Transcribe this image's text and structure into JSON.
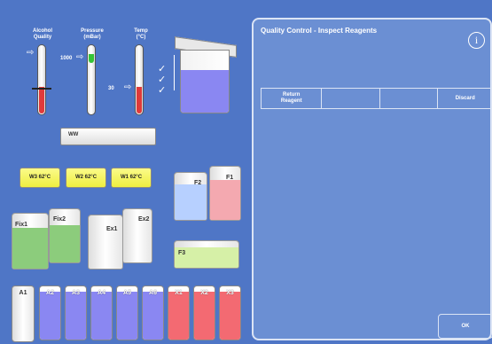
{
  "gauges": {
    "alcohol_label": "Alcohol\nQuality",
    "pressure_label": "Pressure\n(mBar)",
    "temp_label": "Temp\n(°C)",
    "pressure_value": "1000",
    "temp_value": "30"
  },
  "wax_tray": {
    "label": "WW"
  },
  "wax_baths": [
    {
      "label": "W3   62°C"
    },
    {
      "label": "W2   62°C"
    },
    {
      "label": "W1   62°C"
    }
  ],
  "formalin": [
    {
      "label": "F2"
    },
    {
      "label": "F1"
    },
    {
      "label": "F3"
    }
  ],
  "fix_bottles": [
    {
      "label": "Fix1"
    },
    {
      "label": "Fix2"
    }
  ],
  "ex_bottles": [
    {
      "label": "Ex1"
    },
    {
      "label": "Ex2"
    }
  ],
  "reagent_bottles": [
    {
      "label": "A1"
    },
    {
      "label": "A2"
    },
    {
      "label": "A3"
    },
    {
      "label": "A4"
    },
    {
      "label": "A5"
    },
    {
      "label": "A6"
    },
    {
      "label": "X1"
    },
    {
      "label": "X2"
    },
    {
      "label": "X3"
    }
  ],
  "panel": {
    "title": "Quality Control - Inspect Reagents",
    "info_icon": "i",
    "columns": [
      "Return\nReagent",
      "",
      "",
      "Discard"
    ],
    "ok_label": "OK"
  },
  "colors": {
    "background": "#4f76c6",
    "panel": "#6b8fd3",
    "alcohol": "#e03a3a",
    "pressure": "#35c435",
    "reagent_purple": "#8a87f2",
    "xylene_red": "#f36a72",
    "fix_green": "#8ccc7c",
    "formalin_blue": "#b7d0ff",
    "formalin_pink": "#f4a9b0",
    "formalin_green": "#d6f0a7"
  }
}
